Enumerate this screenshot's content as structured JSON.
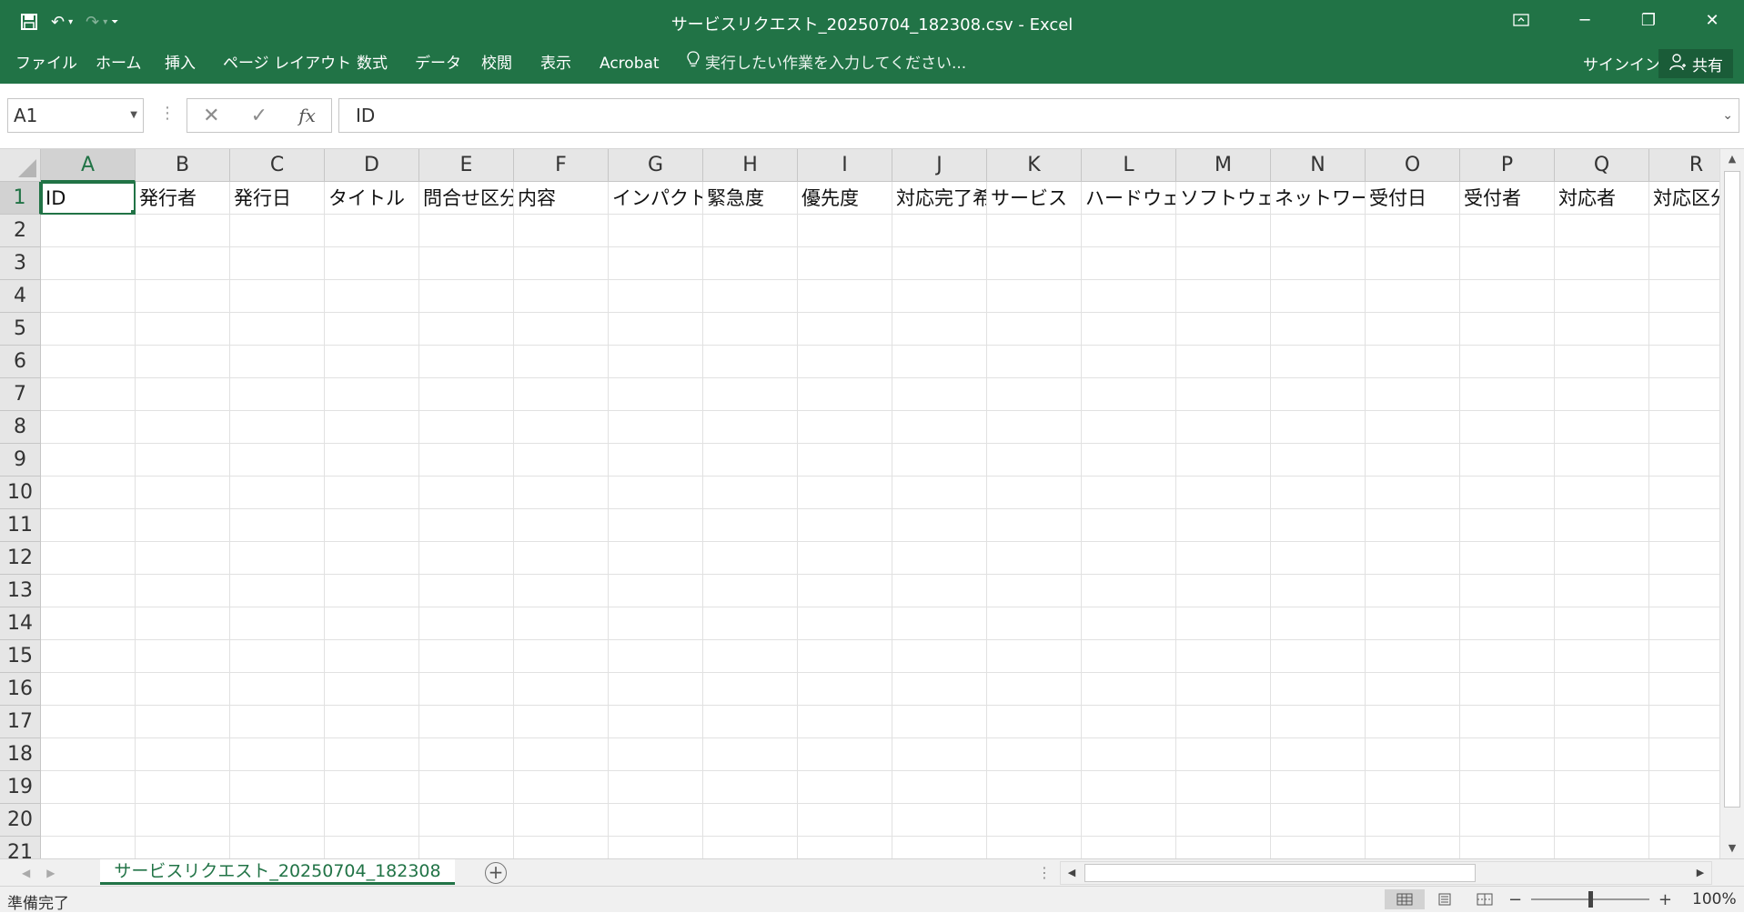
{
  "window": {
    "title": "サービスリクエスト_20250704_182308.csv - Excel"
  },
  "ribbon": {
    "tabs": [
      "ファイル",
      "ホーム",
      "挿入",
      "ページ レイアウト",
      "数式",
      "データ",
      "校閲",
      "表示",
      "Acrobat"
    ],
    "tell_me": "実行したい作業を入力してください...",
    "signin": "サインイン",
    "share": "共有"
  },
  "formula_bar": {
    "name_box": "A1",
    "formula": "ID"
  },
  "sheet": {
    "columns": [
      "A",
      "B",
      "C",
      "D",
      "E",
      "F",
      "G",
      "H",
      "I",
      "J",
      "K",
      "L",
      "M",
      "N",
      "O",
      "P",
      "Q",
      "R"
    ],
    "rows": [
      "1",
      "2",
      "3",
      "4",
      "5",
      "6",
      "7",
      "8",
      "9",
      "10",
      "11",
      "12",
      "13",
      "14",
      "15",
      "16",
      "17",
      "18",
      "19",
      "20",
      "21"
    ],
    "row1_values": [
      "ID",
      "発行者",
      "発行日",
      "タイトル",
      "問合せ区分",
      "内容",
      "インパクト",
      "緊急度",
      "優先度",
      "対応完了希",
      "サービス",
      "ハードウェ",
      "ソフトウェ",
      "ネットワー",
      "受付日",
      "受付者",
      "対応者",
      "対応区分"
    ],
    "active_cell": "A1",
    "tab_name": "サービスリクエスト_20250704_182308"
  },
  "status": {
    "text": "準備完了",
    "zoom": "100%",
    "zoom_fraction": 0.5
  }
}
